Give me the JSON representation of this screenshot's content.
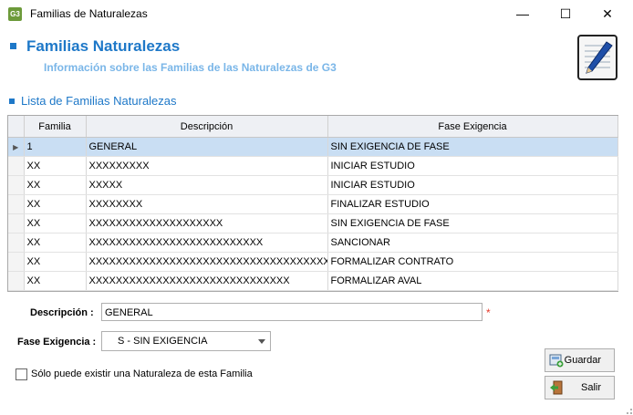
{
  "window": {
    "app_icon": "G3",
    "title": "Familias de Naturalezas",
    "minimize": "—",
    "maximize": "☐",
    "close": "✕"
  },
  "header": {
    "title": "Familias Naturalezas",
    "subtitle": "Información sobre las Familias de las Naturalezas de G3",
    "icon": "notepad-pen-icon"
  },
  "list": {
    "title": "Lista de Familias Naturalezas",
    "columns": [
      "Familia",
      "Descripción",
      "Fase Exigencia"
    ],
    "rows": [
      {
        "familia": "1",
        "descripcion": "GENERAL",
        "fase": "SIN EXIGENCIA DE FASE"
      },
      {
        "familia": "XX",
        "descripcion": "XXXXXXXXX",
        "fase": "INICIAR ESTUDIO"
      },
      {
        "familia": "XX",
        "descripcion": "XXXXX",
        "fase": "INICIAR ESTUDIO"
      },
      {
        "familia": "XX",
        "descripcion": "XXXXXXXX",
        "fase": "FINALIZAR ESTUDIO"
      },
      {
        "familia": "XX",
        "descripcion": "XXXXXXXXXXXXXXXXXXXX",
        "fase": "SIN EXIGENCIA DE FASE"
      },
      {
        "familia": "XX",
        "descripcion": "XXXXXXXXXXXXXXXXXXXXXXXXXX",
        "fase": "SANCIONAR"
      },
      {
        "familia": "XX",
        "descripcion": "XXXXXXXXXXXXXXXXXXXXXXXXXXXXXXXXXXXXXX",
        "fase": "FORMALIZAR CONTRATO"
      },
      {
        "familia": "XX",
        "descripcion": "XXXXXXXXXXXXXXXXXXXXXXXXXXXXXX",
        "fase": "FORMALIZAR AVAL"
      }
    ]
  },
  "form": {
    "descripcion_label": "Descripción :",
    "descripcion_value": "GENERAL",
    "required_mark": "*",
    "fase_label": "Fase Exigencia :",
    "fase_value": "S - SIN EXIGENCIA",
    "checkbox_label": "Sólo puede existir una Naturaleza de esta Familia"
  },
  "buttons": {
    "guardar": "Guardar",
    "salir": "Salir"
  },
  "colors": {
    "accent": "#1e78c8",
    "subtitle": "#7ab6e8",
    "selected_row": "#c9def3",
    "required": "#e53a2a"
  }
}
